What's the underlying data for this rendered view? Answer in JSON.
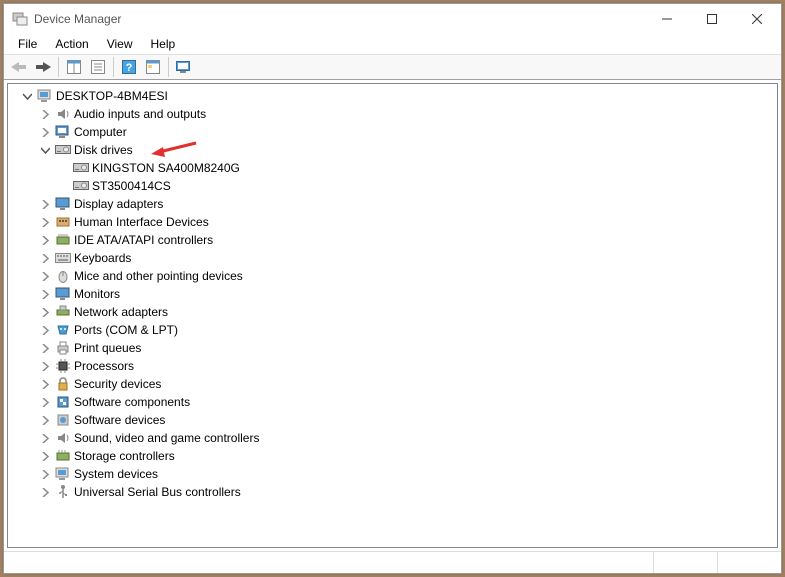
{
  "window": {
    "title": "Device Manager"
  },
  "menu": {
    "file": "File",
    "action": "Action",
    "view": "View",
    "help": "Help"
  },
  "tree": {
    "root": "DESKTOP-4BM4ESI",
    "audio": "Audio inputs and outputs",
    "computer": "Computer",
    "disk_drives": "Disk drives",
    "disk_child_1": "KINGSTON SA400M8240G",
    "disk_child_2": "ST3500414CS",
    "display": "Display adapters",
    "hid": "Human Interface Devices",
    "ide": "IDE ATA/ATAPI controllers",
    "keyboards": "Keyboards",
    "mice": "Mice and other pointing devices",
    "monitors": "Monitors",
    "network": "Network adapters",
    "ports": "Ports (COM & LPT)",
    "printq": "Print queues",
    "processors": "Processors",
    "security": "Security devices",
    "sw_components": "Software components",
    "sw_devices": "Software devices",
    "sound": "Sound, video and game controllers",
    "storage": "Storage controllers",
    "system": "System devices",
    "usb": "Universal Serial Bus controllers"
  }
}
